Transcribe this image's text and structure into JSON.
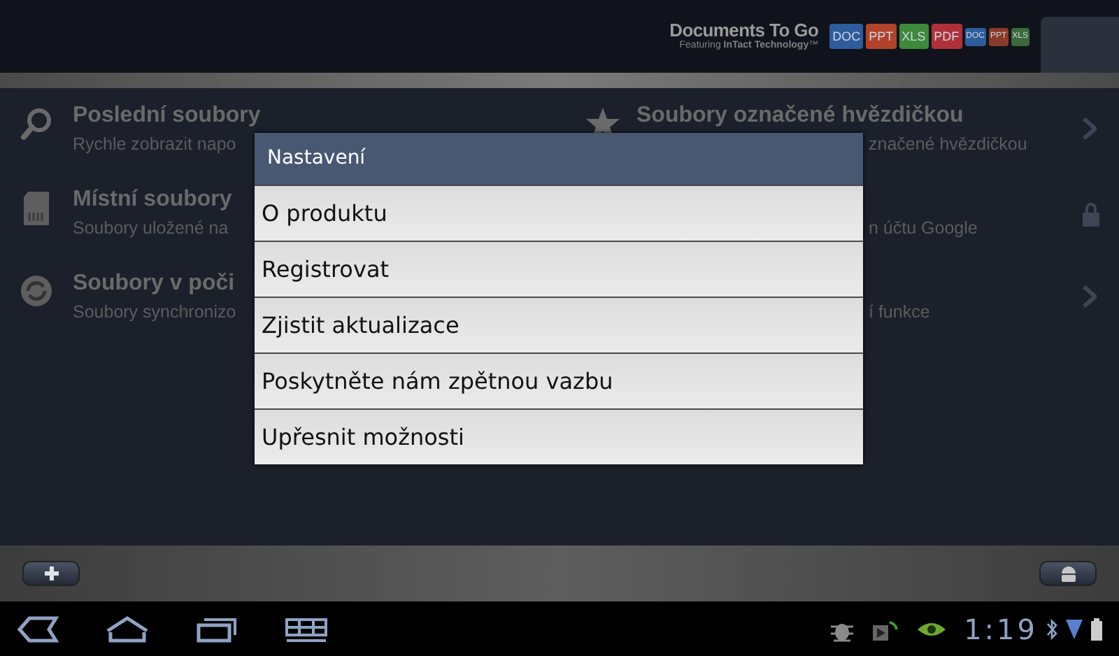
{
  "header": {
    "logo": "Documents To Go",
    "logo_tagline": "Featuring **InTact Technology**™",
    "file_badges": [
      {
        "label": "DOC",
        "color": "#2d5d9c"
      },
      {
        "label": "PPT",
        "color": "#b0432a"
      },
      {
        "label": "XLS",
        "color": "#3d8a3a"
      },
      {
        "label": "PDF",
        "color": "#b0303a"
      },
      {
        "label": "DOC",
        "color": "#2d5d9c"
      },
      {
        "label": "PPT",
        "color": "#8a3a2a"
      },
      {
        "label": "XLS",
        "color": "#3a6a3a"
      }
    ]
  },
  "rows": [
    {
      "left": {
        "kind": "search",
        "title": "Poslední soubory",
        "subtitle": "Rychle zobrazit napo"
      },
      "right": {
        "kind": "star",
        "title": "Soubory označené hvězdičkou",
        "subtitle": "značené hvězdičkou",
        "trail": {
          "kind": "chevron"
        }
      }
    },
    {
      "left": {
        "kind": "sd",
        "title": "Místní soubory",
        "subtitle": "Soubory uložené na"
      },
      "right": {
        "subtitle": "n účtu Google",
        "trail": {
          "kind": "lock"
        }
      }
    },
    {
      "left": {
        "kind": "sync",
        "title": "Soubory v poči",
        "subtitle": "Soubory synchronizo"
      },
      "right": {
        "subtitle": "í funkce",
        "trail": {
          "kind": "chevron"
        }
      }
    }
  ],
  "dialog": {
    "title": "Nastavení",
    "items": [
      "O produktu",
      "Registrovat",
      "Zjistit aktualizace",
      "Poskytněte nám zpětnou vazbu",
      "Upřesnit možnosti"
    ]
  },
  "bottom_bar": {
    "buttons": [
      {
        "kind": "add"
      },
      {
        "kind": "android"
      }
    ]
  },
  "nav_bar": {
    "buttons": [
      {
        "kind": "back"
      },
      {
        "kind": "home"
      },
      {
        "kind": "recents"
      },
      {
        "kind": "grid"
      }
    ],
    "status_icons": [
      {
        "kind": "debug"
      },
      {
        "kind": "play"
      },
      {
        "kind": "nvidia"
      }
    ],
    "time": "1:19",
    "system_icons": [
      {
        "kind": "bluetooth"
      },
      {
        "kind": "signal"
      },
      {
        "kind": "battery"
      }
    ]
  }
}
